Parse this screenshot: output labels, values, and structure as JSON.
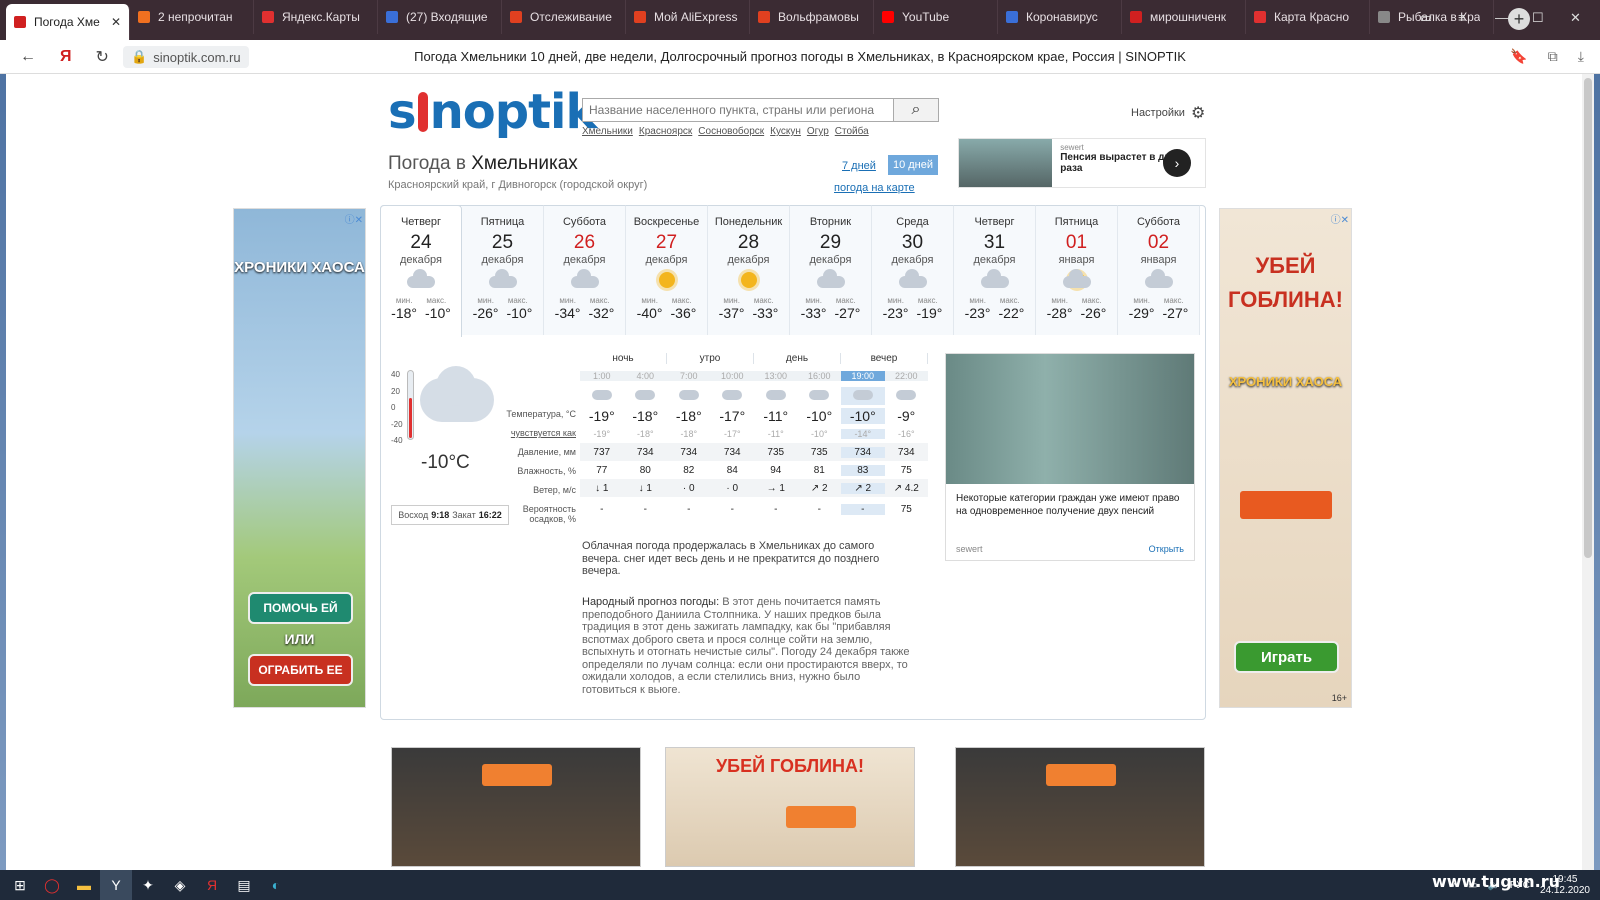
{
  "browser": {
    "tabs": [
      {
        "label": "Погода Хме",
        "active": true,
        "color": "#d02020"
      },
      {
        "label": "2 непрочитан",
        "color": "#f07020"
      },
      {
        "label": "Яндекс.Карты",
        "color": "#e03030"
      },
      {
        "label": "(27) Входящие",
        "color": "#3a6fd8"
      },
      {
        "label": "Отслеживание",
        "color": "#e04020"
      },
      {
        "label": "Мой AliExpress",
        "color": "#e04020"
      },
      {
        "label": "Вольфрамовы",
        "color": "#e04020"
      },
      {
        "label": "YouTube",
        "color": "#ff0000"
      },
      {
        "label": "Коронавирус",
        "color": "#3a6fd8"
      },
      {
        "label": "мирошниченк",
        "color": "#d02020"
      },
      {
        "label": "Карта Красно",
        "color": "#e03030"
      },
      {
        "label": "Рыбалка в Кра",
        "color": "#888888"
      }
    ],
    "url": "sinoptik.com.ru",
    "page_title": "Погода Хмельники 10 дней, две недели, Долгосрочный прогноз погоды в Хмельниках, в Красноярском крае, Россия | SINOPTIK"
  },
  "site": {
    "logo": "sinoptik",
    "search_placeholder": "Название населенного пункта, страны или региона",
    "quick_links": [
      "Хмельники",
      "Красноярск",
      "Сосновоборск",
      "Кускун",
      "Огур",
      "Стойба"
    ],
    "settings": "Настройки",
    "heading_prefix": "Погода в",
    "heading_city": "Хмельниках",
    "region": "Красноярский край, г Дивногорск (городской округ)",
    "period_7": "7 дней",
    "period_10": "10 дней",
    "map_link": "погода на карте"
  },
  "top_ad": {
    "source": "sewert",
    "text": "Пенсия вырастет в два раза"
  },
  "days": [
    {
      "name": "Четверг",
      "date": "24",
      "month": "декабря",
      "min": "-18°",
      "max": "-10°",
      "red": false,
      "icon": "cloud-snow",
      "selected": true
    },
    {
      "name": "Пятница",
      "date": "25",
      "month": "декабря",
      "min": "-26°",
      "max": "-10°",
      "red": false,
      "icon": "cloud-snow"
    },
    {
      "name": "Суббота",
      "date": "26",
      "month": "декабря",
      "min": "-34°",
      "max": "-32°",
      "red": true,
      "icon": "cloud"
    },
    {
      "name": "Воскресенье",
      "date": "27",
      "month": "декабря",
      "min": "-40°",
      "max": "-36°",
      "red": true,
      "icon": "sun"
    },
    {
      "name": "Понедельник",
      "date": "28",
      "month": "декабря",
      "min": "-37°",
      "max": "-33°",
      "red": false,
      "icon": "sun"
    },
    {
      "name": "Вторник",
      "date": "29",
      "month": "декабря",
      "min": "-33°",
      "max": "-27°",
      "red": false,
      "icon": "cloud"
    },
    {
      "name": "Среда",
      "date": "30",
      "month": "декабря",
      "min": "-23°",
      "max": "-19°",
      "red": false,
      "icon": "cloud"
    },
    {
      "name": "Четверг",
      "date": "31",
      "month": "декабря",
      "min": "-23°",
      "max": "-22°",
      "red": false,
      "icon": "cloud"
    },
    {
      "name": "Пятница",
      "date": "01",
      "month": "января",
      "min": "-28°",
      "max": "-26°",
      "red": true,
      "icon": "sun-cloud"
    },
    {
      "name": "Суббота",
      "date": "02",
      "month": "января",
      "min": "-29°",
      "max": "-27°",
      "red": true,
      "icon": "cloud"
    }
  ],
  "labels": {
    "min": "мин.",
    "max": "макс."
  },
  "now": {
    "temp": "-10°C",
    "scale": [
      "40",
      "20",
      "0",
      "-20",
      "-40"
    ],
    "sunrise_label": "Восход",
    "sunrise": "9:18",
    "sunset_label": "Закат",
    "sunset": "16:22"
  },
  "detail": {
    "parts": [
      "ночь",
      "утро",
      "день",
      "вечер"
    ],
    "times": [
      "1:00",
      "4:00",
      "7:00",
      "10:00",
      "13:00",
      "16:00",
      "19:00",
      "22:00"
    ],
    "row_labels": {
      "temp": "Температура, °C",
      "feels": "чувствуется как",
      "pressure": "Давление, мм",
      "humidity": "Влажность, %",
      "wind": "Ветер, м/с",
      "precip": "Вероятность осадков, %"
    },
    "temp": [
      "-19°",
      "-18°",
      "-18°",
      "-17°",
      "-11°",
      "-10°",
      "-10°",
      "-9°"
    ],
    "feels": [
      "-19°",
      "-18°",
      "-18°",
      "-17°",
      "-11°",
      "-10°",
      "-14°",
      "-16°"
    ],
    "pressure": [
      "737",
      "734",
      "734",
      "734",
      "735",
      "735",
      "734",
      "734"
    ],
    "humidity": [
      "77",
      "80",
      "82",
      "84",
      "94",
      "81",
      "83",
      "75"
    ],
    "wind": [
      "↓ 1",
      "↓ 1",
      "· 0",
      "· 0",
      "→ 1",
      "↗ 2",
      "↗ 2",
      "↗ 4.2"
    ],
    "precip": [
      "-",
      "-",
      "-",
      "-",
      "-",
      "-",
      "-",
      "75"
    ]
  },
  "description": "Облачная погода продержалась в Хмельниках до самого вечера. снег идет весь день и не прекратится до позднего вечера.",
  "folk_label": "Народный прогноз погоды:",
  "folk_text": "В этот день почитается память преподобного Даниила Столпника. У наших предков была традиция в этот день зажигать лампадку, как бы \"прибавляя вспотмах доброго света и прося солнце сойти на землю, вспыхнуть и отогнать нечистые силы\". Погоду 24 декабря также определяли по лучам солнца: если они простираются вверх, то ожидали холодов, а если стелились вниз, нужно было готовиться к вьюге.",
  "mid_ad": {
    "text": "Некоторые категории граждан уже имеют право на одновременное получение двух пенсий",
    "source": "sewert",
    "open": "Открыть"
  },
  "left_ad": {
    "title": "ХРОНИКИ ХАОСА",
    "btn1": "ПОМОЧЬ ЕЙ",
    "or": "ИЛИ",
    "btn2": "ОГРАБИТЬ ЕЕ"
  },
  "right_ad": {
    "title": "УБЕЙ ГОБЛИНА!",
    "brand": "ХРОНИКИ ХАОСА",
    "btn": "Играть",
    "age": "16+"
  },
  "bottom_ad_title": "УБЕЙ ГОБЛИНА!",
  "taskbar": {
    "lang": "РУС",
    "time": "19:45",
    "date": "24.12.2020",
    "watermark": "www.tugun.ru"
  }
}
